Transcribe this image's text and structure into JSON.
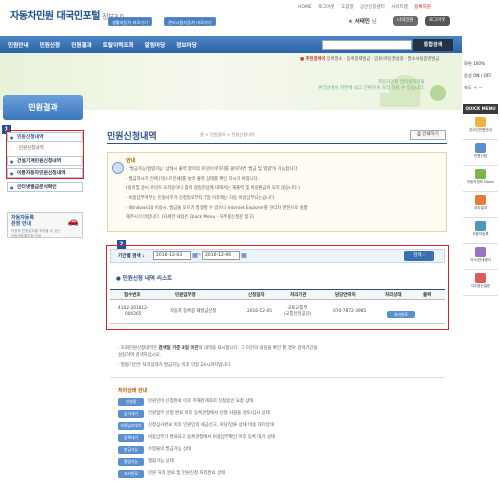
{
  "header": {
    "logo_main": "자동차민원 대국민포털",
    "logo_sub": "정부3.0",
    "btn_site1": "생활자동차 바로가기",
    "btn_site2": "관리시험자동차 바로가기",
    "toplinks": [
      "HOME",
      "로그아웃",
      "도움말",
      "공인인증센터",
      "사이트맵"
    ],
    "toplink_hl": "등록지원",
    "user_name": "서태민",
    "user_suffix": "님",
    "mypage": "나의민원",
    "logout": "로그아웃"
  },
  "nav": {
    "items": [
      "민원안내",
      "민원신청",
      "민원결과",
      "토탈이력조회",
      "알림마당",
      "정보마당"
    ],
    "search_btn": "통합검색"
  },
  "banner": {
    "quick_label": "추천검색어",
    "quick_items": "등록말소 · 등록증재발급 · 압류/저당권설정 · 말소사실증명발급",
    "slogan1": "자동차민원 인터넷처리율",
    "slogan2": "온라인에서 한번에 쉽고 간편하게 처리 하실 수 있습니다."
  },
  "left": {
    "title": "민원결과",
    "menu": [
      {
        "label": "민원신청내역",
        "n": "1"
      },
      {
        "label": "건설기계민원신청내역"
      },
      {
        "label": "이륜자동차민원신청내역"
      },
      {
        "label": "인터넷발급문서확인"
      }
    ],
    "sub": "민원신청내역",
    "car_title1": "자동차등록",
    "car_title2": "관청 안내",
    "car_desc1": "자동차 민원업무를 처리할 수 있는",
    "car_desc2": "자동차등록관청 안내"
  },
  "main": {
    "title": "민원신청내역",
    "breadcrumb": "홈 > 민원결과 > 민원신청내역",
    "print": "인쇄하기",
    "notice_title": "안내",
    "notice_lines": [
      "· '발급가능/열람가능' 상태시 출력 항목의 프린트이미지를 클릭하면 '발급 및 열람'이 가능합니다.",
      "· 발급하시기 전에 [테스트인쇄]를 눌러 출력 상태를 확인 하시기 바랍니다.",
      "  (용지및 글씨 프린트 오작동이나 종이 걸림현상에 대해서는 재출력 및 비용환급이 되지 않습니다.)",
      "· 비용납부여부는 민원사무가 신청일로부터 7일 이후에는 자동 비용납부되는습니다.",
      "· Windows10 이용시, 발급을 모르가 발생할 수 있으니 Internet Explorer를 관리자 권한으로 실행",
      "  해주시기 바랍니다. (자세한 내용은 Quick Menu - 자주묻는질문 참고)"
    ],
    "badge2": "2",
    "date_label": "기간별 검색 :",
    "date_from": "2016-12-03",
    "date_to": "2016-12-06",
    "search_btn": "검색 ›",
    "list_title": "민원신청 내역 리스트",
    "columns": [
      "접수번호",
      "민원업무명",
      "신청일자",
      "처리기관",
      "담당연락처",
      "처리상태",
      "출력"
    ],
    "rows": [
      {
        "no1": "4102-201612-",
        "no2": "000265",
        "task": "자동차 등록증 재발급신청",
        "date": "2016-12-05",
        "org1": "국토교통부",
        "org2": "(교통안전공단)",
        "phone": "070-7872-3985",
        "status": "처리완료"
      }
    ],
    "info1a": "· 조회민원신청내역은 ",
    "info1b": "검색일 기준 3일 이전",
    "info1c": "의 내역을 표시합니다. 그 이전의 내용을 확인 할 경우 검색기간을",
    "info1d": "  설정하여 검색하십시오.",
    "info2": "· 열람기간은 처리상태가 발급가능 이후 익일 24시까지입니다.",
    "status_title": "처리상태 안내",
    "statuses": [
      {
        "badge": "신청중",
        "text": "민원인이 신청완료 이후 이해관계자의 신청승인 요청 상태"
      },
      {
        "badge": "심사대기",
        "text": "민원업무 신청 완료 이후 등록관청에서 신청 사항을 검토/심사 상태"
      },
      {
        "badge": "비용납부대기",
        "text": "신청심사완료 이후 민원인의 세금신고, 저당/압류 상태 비용 대기상태"
      },
      {
        "badge": "등록대기",
        "text": "비용납부가 완료되고 등록관청에서 비용납부확인 이후 등록 대기 상태"
      },
      {
        "badge": "발급가능",
        "text": "수령물의 발급가능 상태"
      },
      {
        "badge": "열람가능",
        "text": "열람가능 상태"
      },
      {
        "badge": "처리완료",
        "text": "민원 처리 완료 및 민원신청 처리완료 상태"
      }
    ]
  },
  "right": {
    "font_label": "화면",
    "font_val": "100%",
    "contrast_label": "음성",
    "contrast_val": "ON / OFF",
    "speed_label": "속도",
    "quick_title": "QUICK MENU",
    "quick_items": [
      "온라인민원안내",
      "민원신청",
      "자동차정보 Down",
      "처리결과",
      "자동차등록",
      "이사/안내센터",
      "자주묻는질문"
    ]
  },
  "colors": {
    "brand": "#2c4f86",
    "nav": "#3a70b4",
    "alert": "#d22"
  }
}
